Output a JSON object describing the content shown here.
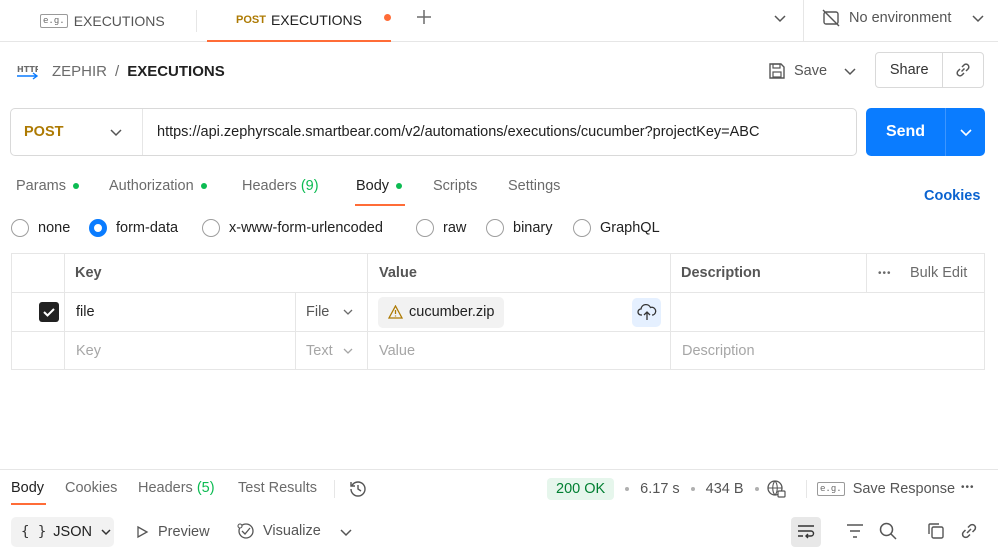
{
  "tabs": [
    {
      "badge": "e.g.",
      "title": "EXECUTIONS"
    },
    {
      "method": "POST",
      "title": "EXECUTIONS"
    }
  ],
  "environment": {
    "label": "No environment"
  },
  "breadcrumb": {
    "parent": "ZEPHIR",
    "separator": "/",
    "current": "EXECUTIONS",
    "icon_label": "HTTP"
  },
  "actions": {
    "save": "Save",
    "share": "Share"
  },
  "request": {
    "method": "POST",
    "url": "https://api.zephyrscale.smartbear.com/v2/automations/executions/cucumber?projectKey=ABC",
    "send": "Send"
  },
  "request_tabs": {
    "params": "Params",
    "authorization": "Authorization",
    "headers": "Headers",
    "headers_count": "(9)",
    "body": "Body",
    "scripts": "Scripts",
    "settings": "Settings",
    "cookies": "Cookies"
  },
  "body_types": {
    "none": "none",
    "form_data": "form-data",
    "urlencoded": "x-www-form-urlencoded",
    "raw": "raw",
    "binary": "binary",
    "graphql": "GraphQL"
  },
  "table": {
    "headers": {
      "key": "Key",
      "value": "Value",
      "description": "Description",
      "bulk_edit": "Bulk Edit",
      "more": "•••"
    },
    "row": {
      "key": "file",
      "type": "File",
      "value": "cucumber.zip"
    },
    "placeholder": {
      "key": "Key",
      "type": "Text",
      "value": "Value",
      "description": "Description"
    }
  },
  "response": {
    "tabs": {
      "body": "Body",
      "cookies": "Cookies",
      "headers": "Headers",
      "headers_count": "(5)",
      "test_results": "Test Results"
    },
    "status": "200 OK",
    "time": "6.17 s",
    "size": "434 B",
    "save_response": "Save Response",
    "more": "•••",
    "format": "JSON",
    "format_braces": "{ }",
    "preview": "Preview",
    "visualize": "Visualize"
  },
  "colors": {
    "accent": "#ff6c37",
    "primary": "#0a7cff",
    "ok": "#007f31",
    "post": "#ad7a03"
  }
}
